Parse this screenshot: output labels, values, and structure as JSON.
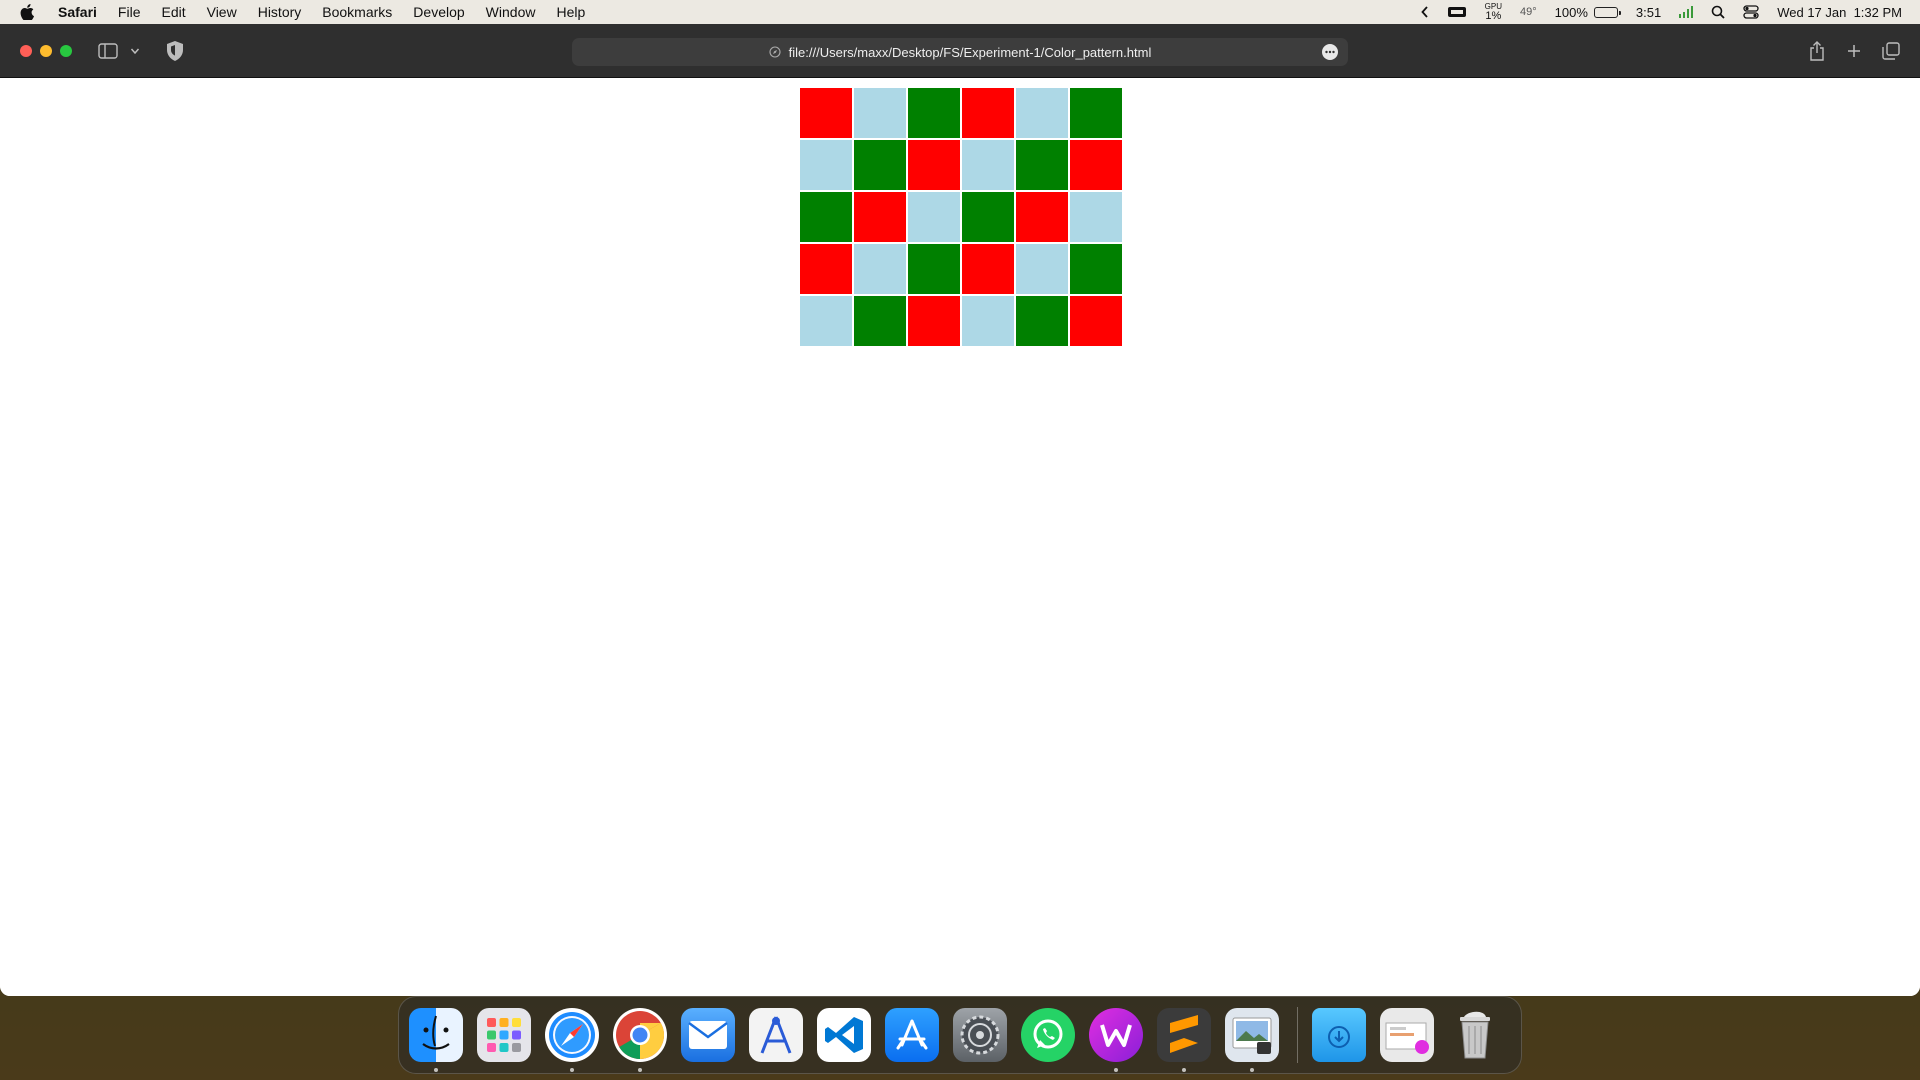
{
  "menubar": {
    "app_name": "Safari",
    "items": [
      "File",
      "Edit",
      "View",
      "History",
      "Bookmarks",
      "Develop",
      "Window",
      "Help"
    ],
    "status": {
      "gpu_label": "GPU",
      "gpu_value": "1%",
      "temperature": "49°",
      "battery_percent": "100%",
      "battery_time": "3:51",
      "datetime": "Wed 17 Jan  1:32 PM"
    }
  },
  "browser": {
    "url": "file:///Users/maxx/Desktop/FS/Experiment-1/Color_pattern.html"
  },
  "pattern": {
    "colors": {
      "R": "#ff0000",
      "B": "#add8e6",
      "G": "#008000"
    },
    "rows": [
      [
        "R",
        "B",
        "G",
        "R",
        "B",
        "G"
      ],
      [
        "B",
        "G",
        "R",
        "B",
        "G",
        "R"
      ],
      [
        "G",
        "R",
        "B",
        "G",
        "R",
        "B"
      ],
      [
        "R",
        "B",
        "G",
        "R",
        "B",
        "G"
      ],
      [
        "B",
        "G",
        "R",
        "B",
        "G",
        "R"
      ]
    ]
  },
  "dock": {
    "apps": [
      {
        "name": "finder",
        "icon": "finder-icon",
        "running": true
      },
      {
        "name": "launchpad",
        "icon": "launchpad-icon",
        "running": false
      },
      {
        "name": "safari",
        "icon": "safari-icon",
        "running": true
      },
      {
        "name": "chrome",
        "icon": "chrome-icon",
        "running": true
      },
      {
        "name": "mail",
        "icon": "mail-icon",
        "running": false
      },
      {
        "name": "instruments",
        "icon": "instruments-icon",
        "running": false
      },
      {
        "name": "vscode",
        "icon": "vscode-icon",
        "running": false
      },
      {
        "name": "appstore",
        "icon": "app-store-icon",
        "running": false
      },
      {
        "name": "settings",
        "icon": "system-settings-icon",
        "running": false
      },
      {
        "name": "whatsapp",
        "icon": "whatsapp-icon",
        "running": false
      },
      {
        "name": "wps",
        "icon": "wps-office-icon",
        "running": true
      },
      {
        "name": "sublime",
        "icon": "sublime-text-icon",
        "running": true
      },
      {
        "name": "preview",
        "icon": "preview-icon",
        "running": true
      }
    ],
    "stacks": [
      {
        "name": "downloads",
        "icon": "downloads-folder-icon"
      },
      {
        "name": "recents",
        "icon": "recent-documents-icon"
      },
      {
        "name": "trash",
        "icon": "trash-icon"
      }
    ]
  }
}
